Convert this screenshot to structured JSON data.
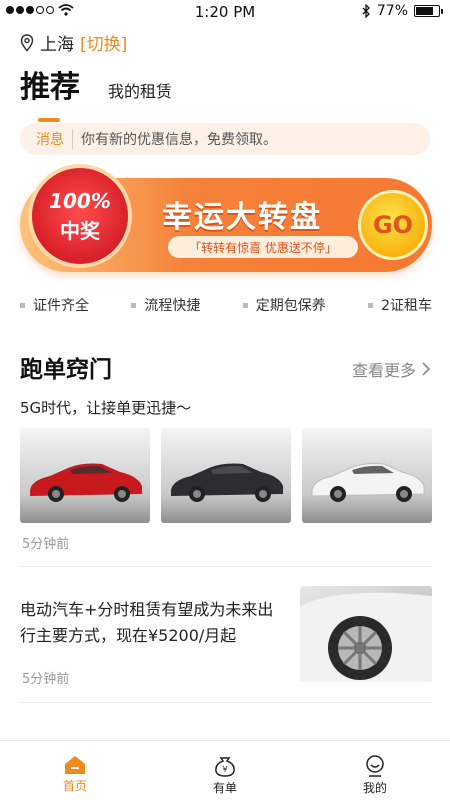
{
  "status": {
    "time": "1:20 PM",
    "battery": "77%",
    "battery_level": 0.77
  },
  "location": {
    "city": "上海",
    "switch_label": "[切换]"
  },
  "tabs": {
    "active": "推荐",
    "other": "我的租赁"
  },
  "notice": {
    "tag": "消息",
    "text": "你有新的优惠信息，免费领取。"
  },
  "banner": {
    "badge_percent": "100%",
    "badge_text": "中奖",
    "title": "幸运大转盘",
    "subtitle": "「转转有惊喜 优惠送不停」",
    "go_label": "GO"
  },
  "features": [
    "证件齐全",
    "流程快捷",
    "定期包保养",
    "2证租车"
  ],
  "section": {
    "title": "跑单窍门",
    "more_label": "查看更多",
    "subtitle": "5G时代，让接单更迅捷～"
  },
  "cars": [
    {
      "color": "#c8191e"
    },
    {
      "color": "#2b2d31"
    },
    {
      "color": "#f4f4f4"
    }
  ],
  "post1": {
    "time": "5分钟前"
  },
  "post2": {
    "title": "电动汽车+分时租赁有望成为未来出行主要方式，现在¥5200/月起",
    "time": "5分钟前"
  },
  "nav": {
    "home": "首页",
    "orders": "有单",
    "mine": "我的",
    "accent": "#f08a1c"
  }
}
